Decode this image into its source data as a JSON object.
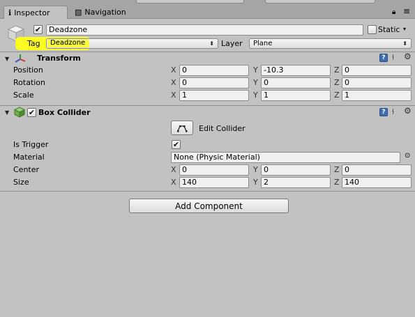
{
  "tabs": [
    {
      "label": "Inspector",
      "icon": "info-icon",
      "active": true
    },
    {
      "label": "Navigation",
      "icon": "navigation-icon",
      "active": false
    }
  ],
  "object": {
    "active": true,
    "name": "Deadzone",
    "static_label": "Static",
    "static_checked": false,
    "tag_label": "Tag",
    "tag_value": "Deadzone",
    "layer_label": "Layer",
    "layer_value": "Plane"
  },
  "transform": {
    "title": "Transform",
    "rows": [
      {
        "label": "Position",
        "x": "0",
        "y": "-10.3",
        "z": "0"
      },
      {
        "label": "Rotation",
        "x": "0",
        "y": "0",
        "z": "0"
      },
      {
        "label": "Scale",
        "x": "1",
        "y": "1",
        "z": "1"
      }
    ]
  },
  "box_collider": {
    "title": "Box Collider",
    "enabled": true,
    "edit_collider_label": "Edit Collider",
    "is_trigger_label": "Is Trigger",
    "is_trigger_checked": true,
    "material_label": "Material",
    "material_value": "None (Physic Material)",
    "center_label": "Center",
    "center": {
      "x": "0",
      "y": "0",
      "z": "0"
    },
    "size_label": "Size",
    "size": {
      "x": "140",
      "y": "2",
      "z": "140"
    }
  },
  "axis_labels": {
    "x": "X",
    "y": "Y",
    "z": "Z"
  },
  "add_component_label": "Add Component",
  "colors": {
    "tag_highlight": "#fdfc20",
    "help_icon": "#3f6fb0",
    "panel_bg": "#c2c2c2"
  }
}
